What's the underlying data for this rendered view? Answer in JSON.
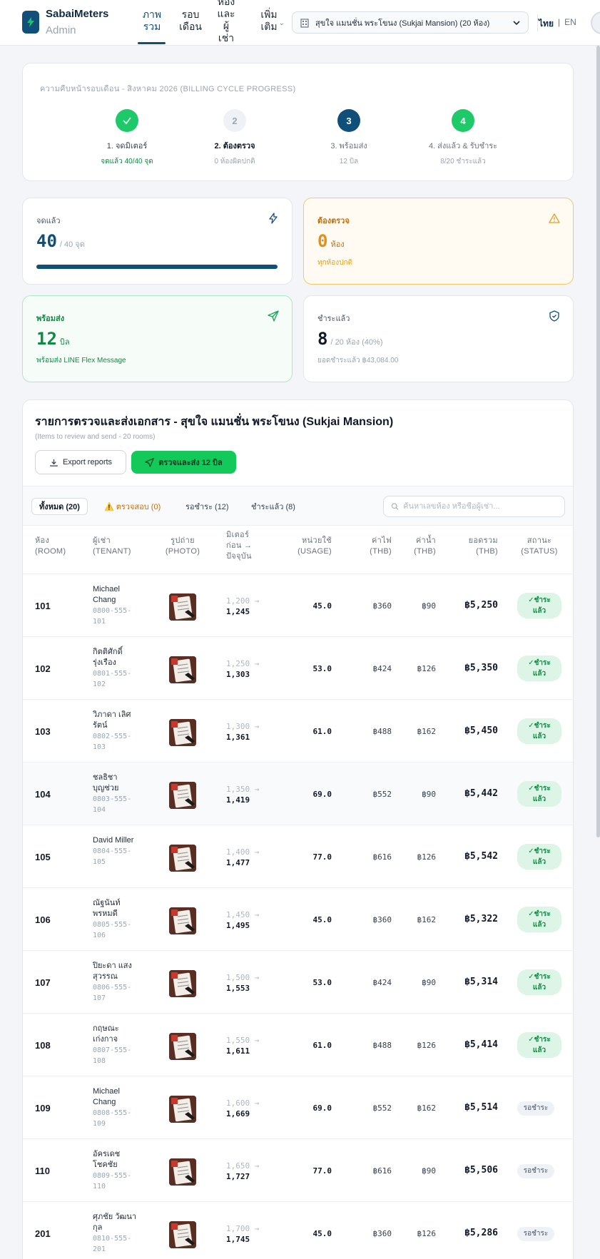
{
  "app": {
    "brand": "SabaiMeters",
    "brand_sub": "Admin",
    "colors": {
      "primary": "#0f4f7a",
      "success": "#12c95a",
      "warning": "#f5b640",
      "danger": "#c2700c"
    }
  },
  "nav": [
    {
      "label": "ภาพ\nรวม",
      "active": true
    },
    {
      "label": "รอบ\nเดือน",
      "active": false
    },
    {
      "label": "ห้อง\nและ\nผู้\nเช่า",
      "active": false
    },
    {
      "label": "เพิ่ม\nเติม",
      "active": false
    }
  ],
  "property_select": {
    "value": "สุขใจ แมนชั่น พระโขนง (Sukjai Mansion) (20 ห้อง)"
  },
  "lang": {
    "th": "ไทย",
    "en": "EN"
  },
  "progress": {
    "title": "ความคืบหน้ารอบเดือน - สิงหาคม 2026 (BILLING CYCLE PROGRESS)",
    "steps": [
      {
        "num": "✓",
        "label": "1. จดมิเตอร์",
        "sub": "จดแล้ว 40/40 จุด",
        "color": "#1ec96a",
        "state": "done"
      },
      {
        "num": "2",
        "label": "2. ต้องตรวจ",
        "sub": "0 ห้องผิดปกติ",
        "color": "#eef2f6",
        "state": "idle"
      },
      {
        "num": "3",
        "label": "3. พร้อมส่ง",
        "sub": "12 บิล",
        "color": "#0f4f7a",
        "state": "current"
      },
      {
        "num": "4",
        "label": "4. ส่งแล้ว & รับชำระ",
        "sub": "8/20 ชำระแล้ว",
        "color": "#1ec96a",
        "state": "done"
      }
    ]
  },
  "stats": {
    "recorded": {
      "title": "จดแล้ว",
      "value": "40",
      "unit": "/ 40 จุด",
      "icon": "lightning-icon",
      "progress": 1.0
    },
    "review": {
      "title": "ต้องตรวจ",
      "value": "0",
      "unit": "ห้อง",
      "note": "ทุกห้องปกติ",
      "icon": "warning-icon"
    },
    "ready": {
      "title": "พร้อมส่ง",
      "value": "12",
      "unit": "บิล",
      "note": "พร้อมส่ง LINE Flex Message",
      "icon": "send-icon"
    },
    "paid": {
      "title": "ชำระแล้ว",
      "value": "8",
      "unit": "/ 20 ห้อง (40%)",
      "note": "ยอดชำระแล้ว ฿43,084.00",
      "icon": "shield-check-icon"
    }
  },
  "table_section": {
    "title": "รายการตรวจและส่งเอกสาร - สุขใจ แมนชั่น พระโขนง (Sukjai Mansion)",
    "subtitle": "(Items to review and send - 20 rooms)",
    "export_label": "Export reports",
    "send_label": "ตรวจและส่ง 12 บิล",
    "filters": [
      {
        "label": "ทั้งหมด (20)",
        "active": true
      },
      {
        "label": "⚠️ ตรวจสอบ (0)",
        "active": false,
        "warn": true
      },
      {
        "label": "รอชำระ (12)",
        "active": false
      },
      {
        "label": "ชำระแล้ว (8)",
        "active": false
      }
    ],
    "search_placeholder": "ค้นหาเลขห้อง หรือชื่อผู้เช่า...",
    "columns": {
      "room": "ห้อง\n(ROOM)",
      "tenant": "ผู้เช่า\n(TENANT)",
      "photo": "รูปถ่าย\n(PHOTO)",
      "meter": "มิเตอร์\nก่อน →\nปัจจุบัน",
      "usage": "หน่วยใช้\n(USAGE)",
      "elec": "ค่าไฟ\n(THB)",
      "water": "ค่าน้ำ\n(THB)",
      "total": "ยอดรวม\n(THB)",
      "status": "สถานะ\n(STATUS)"
    },
    "rows": [
      {
        "room": "101",
        "tenant": "Michael\nChang",
        "phone": "0800-555-\n101",
        "prev": "1,200 →",
        "cur": "1,245",
        "usage": "45.0",
        "elec": "฿360",
        "water": "฿90",
        "total": "฿5,250",
        "status": "✓ชำระ\nแล้ว",
        "paid": true
      },
      {
        "room": "102",
        "tenant": "กิตติศักดิ์\nรุ่งเรือง",
        "phone": "0801-555-\n102",
        "prev": "1,250 →",
        "cur": "1,303",
        "usage": "53.0",
        "elec": "฿424",
        "water": "฿126",
        "total": "฿5,350",
        "status": "✓ชำระ\nแล้ว",
        "paid": true
      },
      {
        "room": "103",
        "tenant": "วิภาดา เลิศ\nรัตน์",
        "phone": "0802-555-\n103",
        "prev": "1,300 →",
        "cur": "1,361",
        "usage": "61.0",
        "elec": "฿488",
        "water": "฿162",
        "total": "฿5,450",
        "status": "✓ชำระ\nแล้ว",
        "paid": true
      },
      {
        "room": "104",
        "tenant": "ชลธิชา\nบุญช่วย",
        "phone": "0803-555-\n104",
        "prev": "1,350 →",
        "cur": "1,419",
        "usage": "69.0",
        "elec": "฿552",
        "water": "฿90",
        "total": "฿5,442",
        "status": "✓ชำระ\nแล้ว",
        "paid": true
      },
      {
        "room": "105",
        "tenant": "David Miller",
        "phone": "0804-555-\n105",
        "prev": "1,400 →",
        "cur": "1,477",
        "usage": "77.0",
        "elec": "฿616",
        "water": "฿126",
        "total": "฿5,542",
        "status": "✓ชำระ\nแล้ว",
        "paid": true
      },
      {
        "room": "106",
        "tenant": "ณัฐนันท์\nพรหมดี",
        "phone": "0805-555-\n106",
        "prev": "1,450 →",
        "cur": "1,495",
        "usage": "45.0",
        "elec": "฿360",
        "water": "฿162",
        "total": "฿5,322",
        "status": "✓ชำระ\nแล้ว",
        "paid": true
      },
      {
        "room": "107",
        "tenant": "ปิยะดา แสง\nสุวรรณ",
        "phone": "0806-555-\n107",
        "prev": "1,500 →",
        "cur": "1,553",
        "usage": "53.0",
        "elec": "฿424",
        "water": "฿90",
        "total": "฿5,314",
        "status": "✓ชำระ\nแล้ว",
        "paid": true
      },
      {
        "room": "108",
        "tenant": "กฤษณะ\nเก่งกาจ",
        "phone": "0807-555-\n108",
        "prev": "1,550 →",
        "cur": "1,611",
        "usage": "61.0",
        "elec": "฿488",
        "water": "฿126",
        "total": "฿5,414",
        "status": "✓ชำระ\nแล้ว",
        "paid": true
      },
      {
        "room": "109",
        "tenant": "Michael\nChang",
        "phone": "0808-555-\n109",
        "prev": "1,600 →",
        "cur": "1,669",
        "usage": "69.0",
        "elec": "฿552",
        "water": "฿162",
        "total": "฿5,514",
        "status": "รอชำระ",
        "paid": false
      },
      {
        "room": "110",
        "tenant": "อัครเดช\nโชคชัย",
        "phone": "0809-555-\n110",
        "prev": "1,650 →",
        "cur": "1,727",
        "usage": "77.0",
        "elec": "฿616",
        "water": "฿90",
        "total": "฿5,506",
        "status": "รอชำระ",
        "paid": false
      },
      {
        "room": "201",
        "tenant": "ศุภชัย วัฒนา\nกุล",
        "phone": "0810-555-\n201",
        "prev": "1,700 →",
        "cur": "1,745",
        "usage": "45.0",
        "elec": "฿360",
        "water": "฿126",
        "total": "฿5,286",
        "status": "รอชำระ",
        "paid": false
      }
    ]
  }
}
